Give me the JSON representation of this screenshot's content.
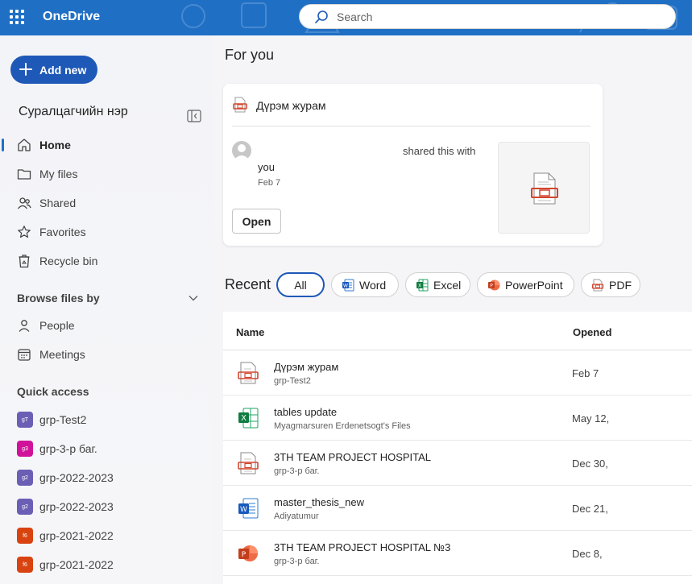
{
  "topbar": {
    "brand": "OneDrive",
    "search_placeholder": "Search"
  },
  "sidebar": {
    "add_new": "Add new",
    "user_name": "Суралцагчийн нэр",
    "nav": [
      {
        "label": "Home",
        "icon": "home-icon",
        "active": true
      },
      {
        "label": "My files",
        "icon": "folder-icon"
      },
      {
        "label": "Shared",
        "icon": "people-icon"
      },
      {
        "label": "Favorites",
        "icon": "star-icon"
      },
      {
        "label": "Recycle bin",
        "icon": "recycle-bin-icon"
      }
    ],
    "browse_heading": "Browse files by",
    "browse": [
      {
        "label": "People",
        "icon": "person-icon"
      },
      {
        "label": "Meetings",
        "icon": "calendar-icon"
      }
    ],
    "quick_access_heading": "Quick access",
    "quick_access": [
      {
        "label": "grp-Test2",
        "badge": "gT",
        "color": "#6b5fb5"
      },
      {
        "label": "grp-3-р баг.",
        "badge": "g3",
        "color": "#d0129b"
      },
      {
        "label": "grp-2022-2023",
        "badge": "g2",
        "color": "#6b5fb5"
      },
      {
        "label": "grp-2022-2023",
        "badge": "g2",
        "color": "#6b5fb5"
      },
      {
        "label": "grp-2021-2022",
        "badge": "f6",
        "color": "#d8430f"
      },
      {
        "label": "grp-2021-2022",
        "badge": "f6",
        "color": "#d8430f"
      }
    ]
  },
  "main": {
    "for_you_heading": "For you",
    "card": {
      "title": "Дүрэм журам",
      "shared_text": "shared this with",
      "you_text": "you",
      "date": "Feb 7",
      "open_label": "Open"
    },
    "recent_heading": "Recent",
    "filters": [
      {
        "label": "All",
        "active": true
      },
      {
        "label": "Word",
        "icon": "word-icon"
      },
      {
        "label": "Excel",
        "icon": "excel-icon"
      },
      {
        "label": "PowerPoint",
        "icon": "powerpoint-icon"
      },
      {
        "label": "PDF",
        "icon": "pdf-icon"
      }
    ],
    "table": {
      "col_name": "Name",
      "col_opened": "Opened",
      "rows": [
        {
          "name": "Дүрэм журам",
          "sub": "grp-Test2",
          "opened": "Feb 7",
          "type": "pdf"
        },
        {
          "name": "tables update",
          "sub": "Myagmarsuren Erdenetsogt's Files",
          "opened": "May 12,",
          "type": "excel"
        },
        {
          "name": "3TH TEAM PROJECT HOSPITAL",
          "sub": "grp-3-р баг.",
          "opened": "Dec 30,",
          "type": "pdf"
        },
        {
          "name": "master_thesis_new",
          "sub": "Adiyatumur",
          "opened": "Dec 21,",
          "type": "word"
        },
        {
          "name": "3TH TEAM PROJECT HOSPITAL №3",
          "sub": "grp-3-р баг.",
          "opened": "Dec 8,",
          "type": "powerpoint"
        }
      ]
    }
  },
  "colors": {
    "topbar": "#1f6fc5",
    "accent": "#1f59b7",
    "pdf": "#d2452e",
    "excel": "#107c41",
    "word": "#185abd",
    "powerpoint": "#c43e1c"
  }
}
